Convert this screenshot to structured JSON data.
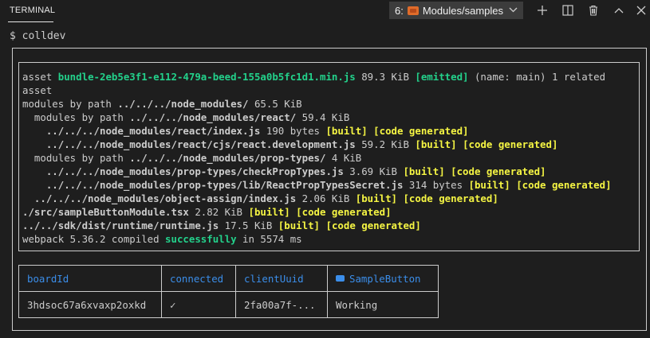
{
  "panel": {
    "title": "TERMINAL",
    "terminal_select": {
      "index": "6:",
      "label": "Modules/samples"
    }
  },
  "toolbar_icons": [
    "plus-icon",
    "split-icon",
    "trash-icon",
    "chevron-up-icon",
    "close-icon"
  ],
  "terminal": {
    "prompt": "$ colldev",
    "log": [
      [
        {
          "t": "asset "
        },
        {
          "t": "bundle-2eb5e3f1-e112-479a-beed-155a0b5fc1d1.min.js",
          "c": "g b"
        },
        {
          "t": " 89.3 KiB "
        },
        {
          "t": "[emitted]",
          "c": "g b"
        },
        {
          "t": " (name: main) 1 related"
        }
      ],
      [
        {
          "t": "asset"
        }
      ],
      [
        {
          "t": "modules by path "
        },
        {
          "t": "../../../node_modules/",
          "c": "b"
        },
        {
          "t": " 65.5 KiB"
        }
      ],
      [
        {
          "t": "  modules by path "
        },
        {
          "t": "../../../node_modules/react/",
          "c": "b"
        },
        {
          "t": " 59.4 KiB"
        }
      ],
      [
        {
          "t": "    "
        },
        {
          "t": "../../../node_modules/react/index.js",
          "c": "b"
        },
        {
          "t": " 190 bytes "
        },
        {
          "t": "[built]",
          "c": "y b"
        },
        {
          "t": " "
        },
        {
          "t": "[code generated]",
          "c": "y b"
        }
      ],
      [
        {
          "t": "    "
        },
        {
          "t": "../../../node_modules/react/cjs/react.development.js",
          "c": "b"
        },
        {
          "t": " 59.2 KiB "
        },
        {
          "t": "[built]",
          "c": "y b"
        },
        {
          "t": " "
        },
        {
          "t": "[code generated]",
          "c": "y b"
        }
      ],
      [
        {
          "t": "  modules by path "
        },
        {
          "t": "../../../node_modules/prop-types/",
          "c": "b"
        },
        {
          "t": " 4 KiB"
        }
      ],
      [
        {
          "t": "    "
        },
        {
          "t": "../../../node_modules/prop-types/checkPropTypes.js",
          "c": "b"
        },
        {
          "t": " 3.69 KiB "
        },
        {
          "t": "[built]",
          "c": "y b"
        },
        {
          "t": " "
        },
        {
          "t": "[code generated]",
          "c": "y b"
        }
      ],
      [
        {
          "t": "    "
        },
        {
          "t": "../../../node_modules/prop-types/lib/ReactPropTypesSecret.js",
          "c": "b"
        },
        {
          "t": " 314 bytes "
        },
        {
          "t": "[built]",
          "c": "y b"
        },
        {
          "t": " "
        },
        {
          "t": "[code generated]",
          "c": "y b"
        }
      ],
      [
        {
          "t": "  "
        },
        {
          "t": "../../../node_modules/object-assign/index.js",
          "c": "b"
        },
        {
          "t": " 2.06 KiB "
        },
        {
          "t": "[built]",
          "c": "y b"
        },
        {
          "t": " "
        },
        {
          "t": "[code generated]",
          "c": "y b"
        }
      ],
      [
        {
          "t": "./src/sampleButtonModule.tsx",
          "c": "b"
        },
        {
          "t": " 2.82 KiB "
        },
        {
          "t": "[built]",
          "c": "y b"
        },
        {
          "t": " "
        },
        {
          "t": "[code generated]",
          "c": "y b"
        }
      ],
      [
        {
          "t": "../../sdk/dist/runtime/runtime.js",
          "c": "b"
        },
        {
          "t": " 17.5 KiB "
        },
        {
          "t": "[built]",
          "c": "y b"
        },
        {
          "t": " "
        },
        {
          "t": "[code generated]",
          "c": "y b"
        }
      ],
      [
        {
          "t": "webpack 5.36.2 compiled "
        },
        {
          "t": "successfully",
          "c": "g b"
        },
        {
          "t": " in 5574 ms"
        }
      ]
    ]
  },
  "status_table": {
    "headers": [
      "boardId",
      "connected",
      "clientUuid",
      "SampleButton"
    ],
    "row": [
      "3hdsoc67a6xvaxp2oxkd",
      "✓",
      "2fa00a7f-...",
      "Working"
    ]
  },
  "colors": {
    "green": "#23d18b",
    "yellow": "#f5f543",
    "blue": "#3b8eea",
    "foreground": "#cccccc",
    "background": "#1e1e1e"
  }
}
